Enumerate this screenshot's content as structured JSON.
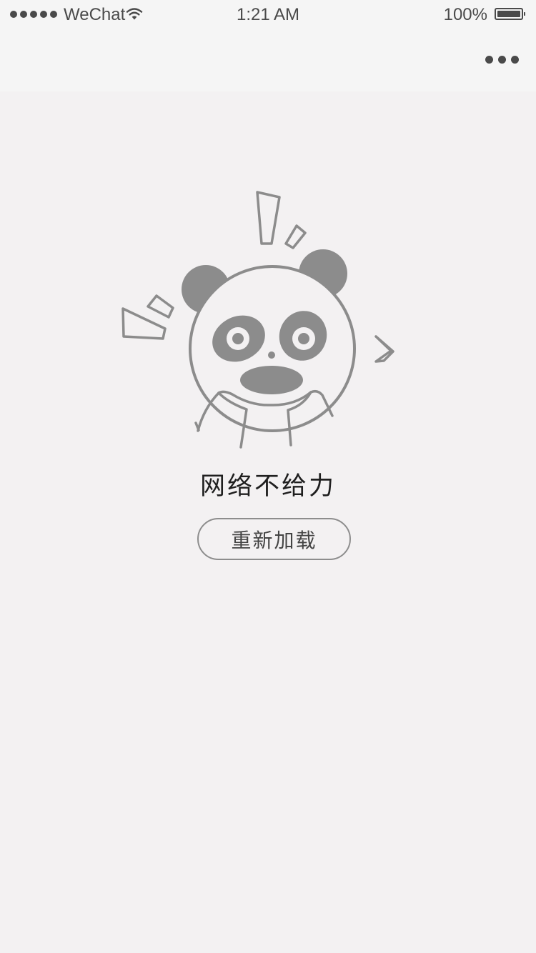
{
  "status_bar": {
    "carrier": "WeChat",
    "time": "1:21 AM",
    "battery": "100%",
    "signal_icon": "signal-dots-icon",
    "wifi_icon": "wifi-icon",
    "battery_icon": "battery-icon",
    "battery_level": 1.0
  },
  "nav": {
    "more_icon": "more-dots-icon"
  },
  "error": {
    "illustration": "panda-illustration",
    "message": "网络不给力",
    "reload_label": "重新加载"
  },
  "colors": {
    "background": "#f3f1f2",
    "nav_background": "#f5f5f5",
    "illustration_gray": "#8c8c8c",
    "text": "#1f1f1f",
    "button_border": "#8d8d8d"
  }
}
